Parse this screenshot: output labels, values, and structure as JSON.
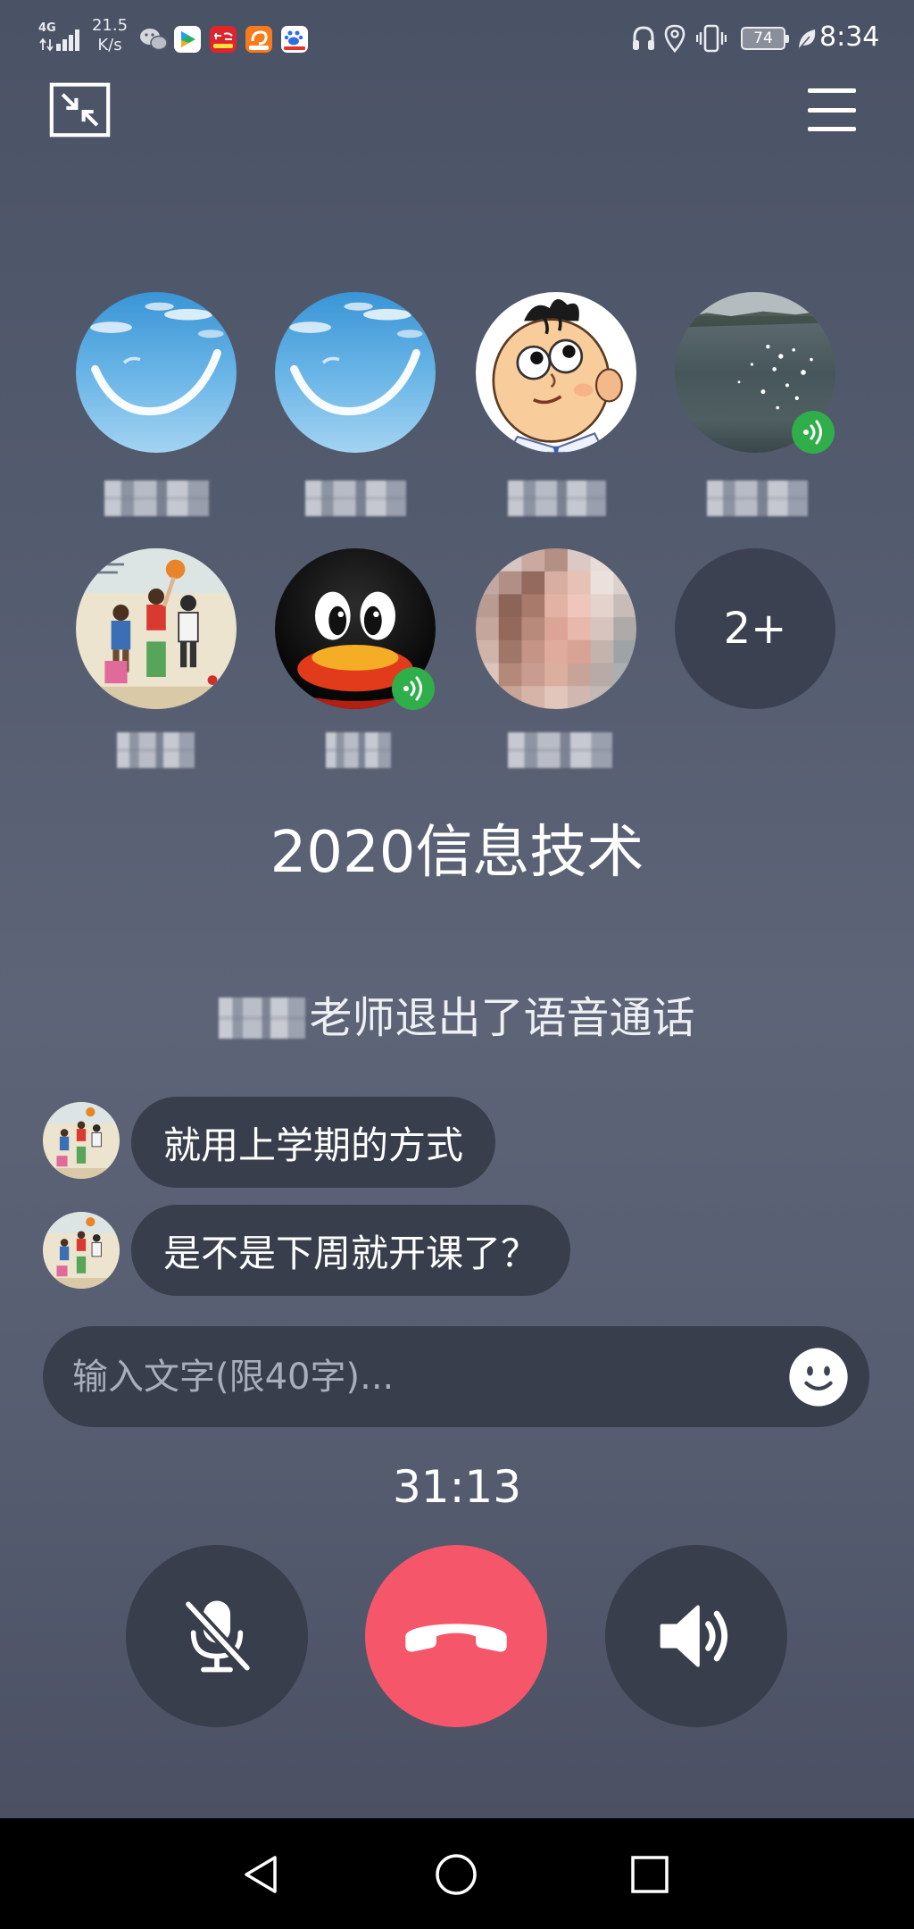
{
  "status_bar": {
    "network_type": "4G",
    "net_speed": "21.5",
    "net_speed_unit": "K/s",
    "notification_icons": [
      "signal-icon",
      "wechat-icon",
      "video-app-icon",
      "red-app-icon",
      "orange-app-icon",
      "baidu-app-icon"
    ],
    "system_icons": [
      "headphones-icon",
      "location-icon",
      "vibrate-icon",
      "battery-icon",
      "power-saving-leaf-icon"
    ],
    "battery_level": "74",
    "time": "8:34"
  },
  "top_bar": {
    "minimize_icon": "minimize-icon",
    "menu_icon": "menu-icon"
  },
  "participants": [
    {
      "avatar_icon": "sky-smile-avatar",
      "speaking": false
    },
    {
      "avatar_icon": "sky-smile-avatar",
      "speaking": false
    },
    {
      "avatar_icon": "cartoon-boy-avatar",
      "speaking": false
    },
    {
      "avatar_icon": "lake-water-avatar",
      "speaking": true
    },
    {
      "avatar_icon": "basketball-cartoon-avatar",
      "speaking": false
    },
    {
      "avatar_icon": "qq-penguin-avatar",
      "speaking": true
    },
    {
      "avatar_icon": "pixelated-photo-avatar",
      "speaking": false
    }
  ],
  "more_participants": "2+",
  "group_name": "2020信息技术",
  "system_notice": "老师退出了语音通话",
  "messages": [
    {
      "avatar_icon": "basketball-cartoon-avatar",
      "text": "就用上学期的方式"
    },
    {
      "avatar_icon": "basketball-cartoon-avatar",
      "text": "是不是下周就开课了？"
    }
  ],
  "input": {
    "placeholder": "输入文字(限40字)...",
    "emoji_icon": "emoji-icon"
  },
  "call_duration": "31:13",
  "controls": {
    "mute_icon": "microphone-off-icon",
    "hangup_icon": "hang-up-phone-icon",
    "speaker_icon": "speaker-icon"
  },
  "nav_bar": {
    "back_icon": "back-triangle-icon",
    "home_icon": "home-circle-icon",
    "recents_icon": "recents-square-icon"
  },
  "colors": {
    "background": "#535b6e",
    "hangup_button": "#f5566a",
    "control_button": "#393e4c",
    "speaking_badge": "#2fae4a",
    "chat_bubble": "#383e4b"
  }
}
